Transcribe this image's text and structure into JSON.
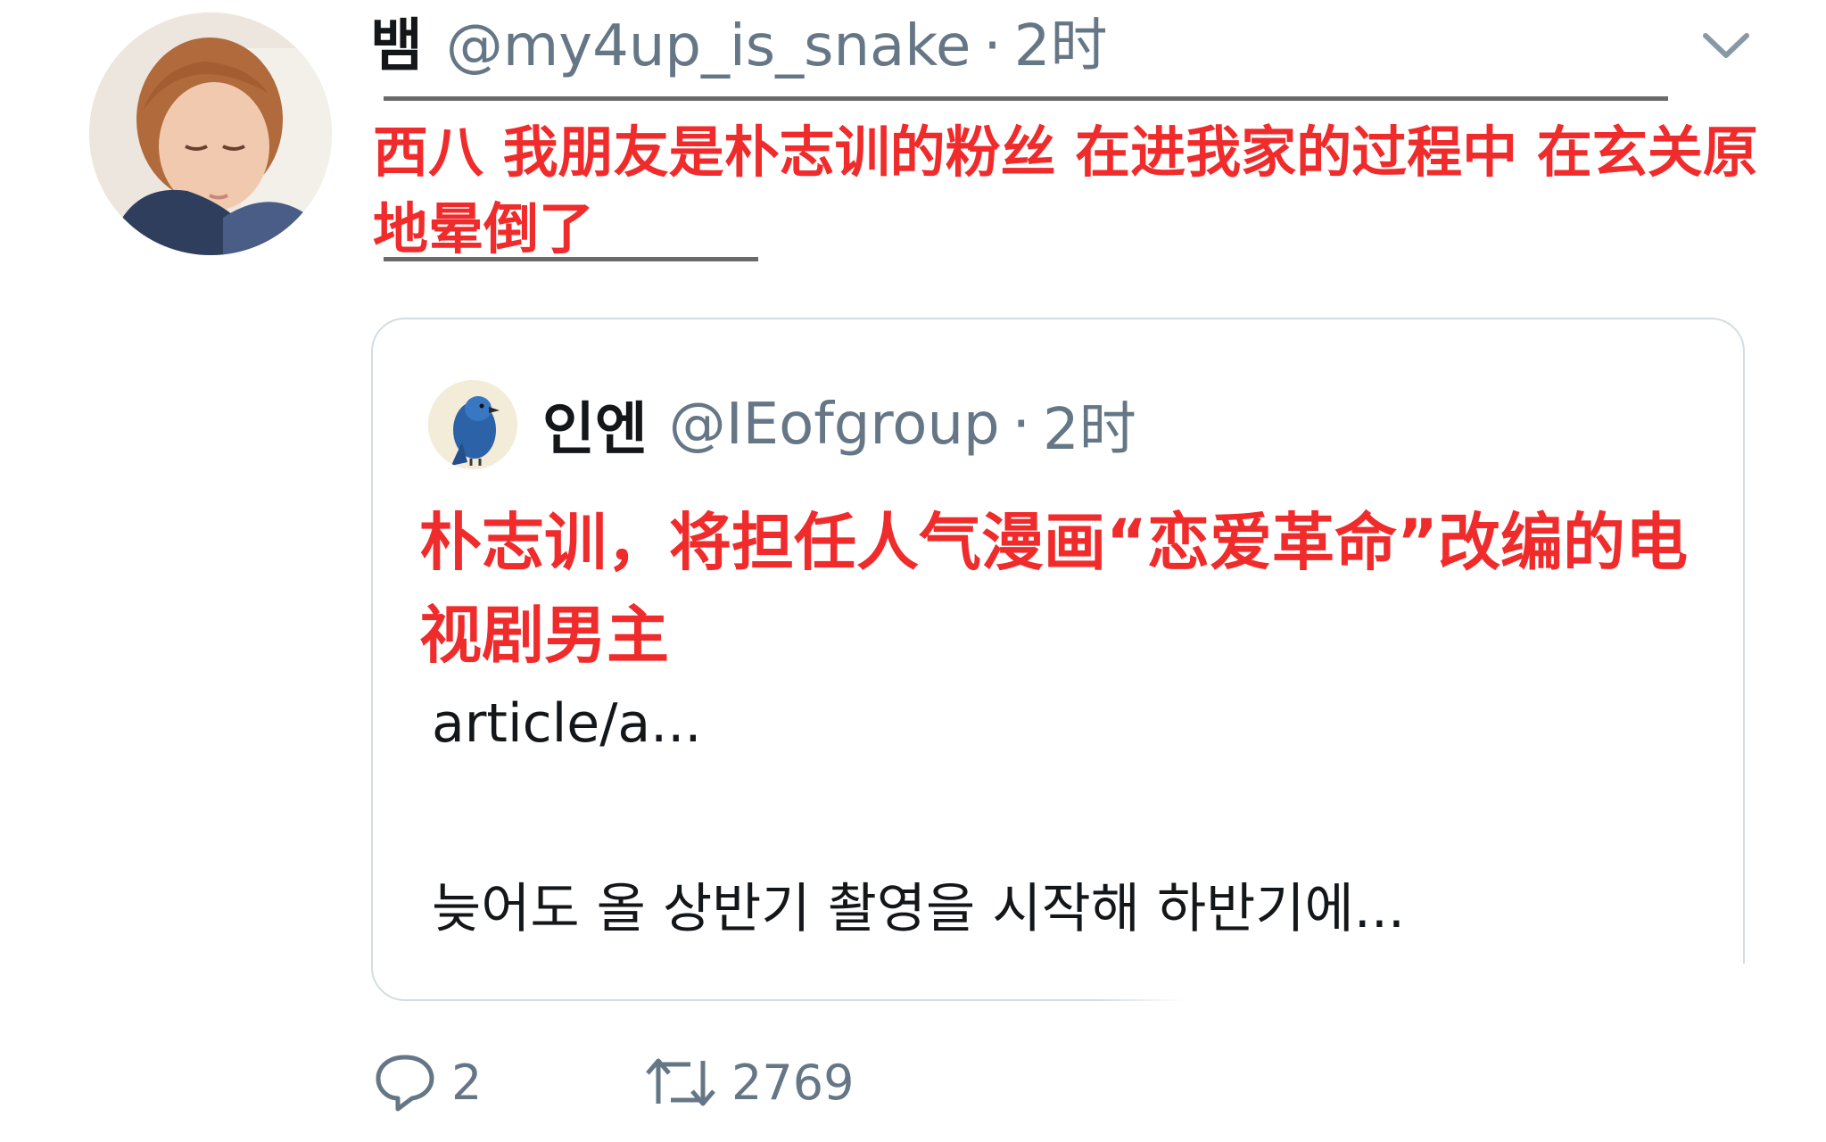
{
  "tweet": {
    "author": {
      "display_name": "뱀",
      "handle": "@my4up_is_snake",
      "separator": "·",
      "time": "2时",
      "avatar_icon": "profile-photo"
    },
    "overlay_caption": "西八 我朋友是朴志训的粉丝 在进我家的过程中 在玄关原地晕倒了",
    "menu_icon": "chevron-down-icon"
  },
  "quoted": {
    "author": {
      "display_name": "인엔",
      "handle": "@IEofgroup",
      "separator": "·",
      "time": "2时",
      "avatar_icon": "blue-bird-avatar"
    },
    "overlay_caption": "朴志训，将担任人气漫画“恋爱革命”改编的电视剧男主",
    "link_text": "article/a...",
    "snippet": "늦어도 올 상반기 촬영을 시작해 하반기에..."
  },
  "actions": {
    "reply_count": "2",
    "retweet_count": "2769",
    "reply_icon": "reply-icon",
    "retweet_icon": "retweet-icon"
  },
  "colors": {
    "overlay_red": "#f02b2b",
    "meta_gray": "#657786",
    "card_border": "#d3dce3"
  }
}
